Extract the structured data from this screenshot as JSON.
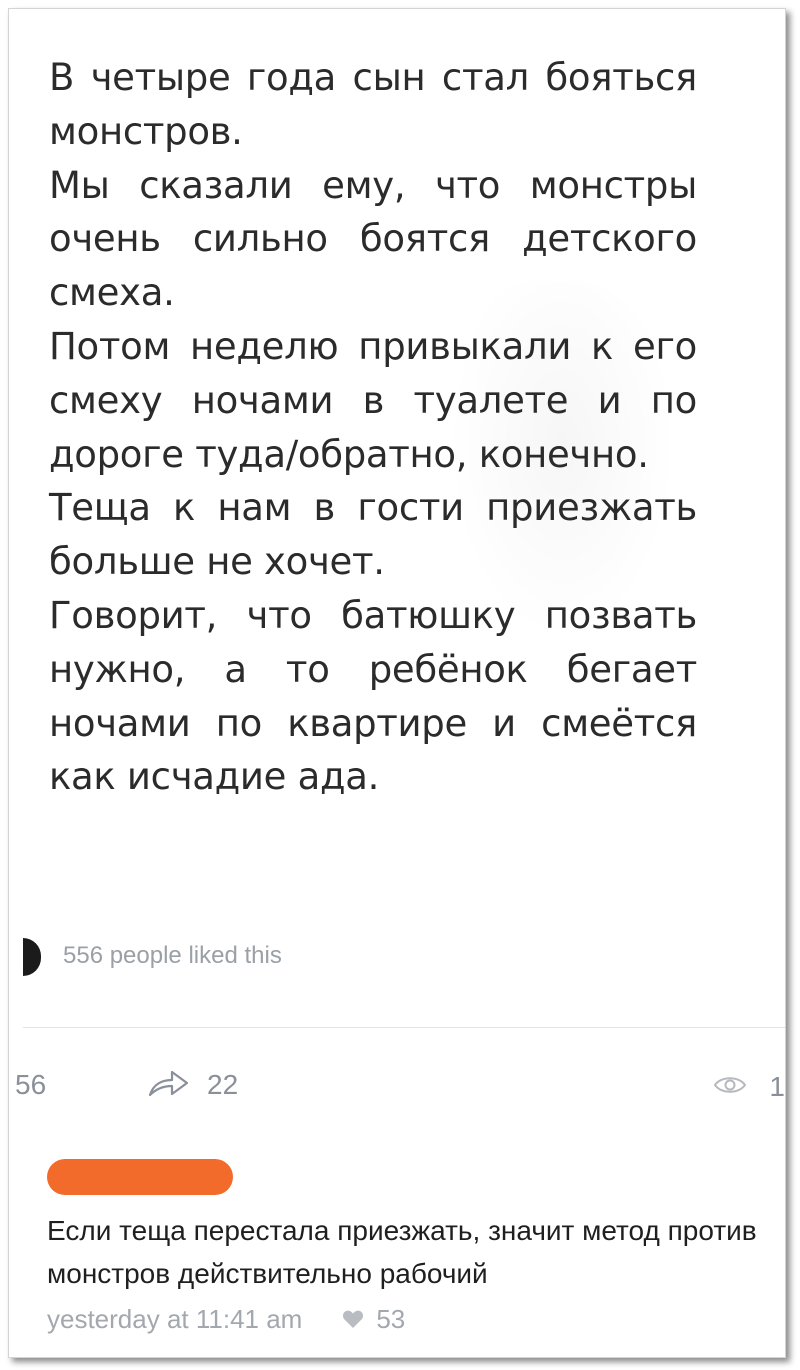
{
  "post": {
    "paragraphs": [
      "В четыре года сын стал бояться монстров.",
      "Мы сказали ему, что монстры очень сильно боятся детского смеха.",
      "Потом неделю привыкали к его смеху ночами в туалете и по дороге туда/обратно, конечно.",
      "Теща к нам в гости приезжать больше не хочет.",
      "Говорит, что батюшку позвать нужно, а то ребёнок бегает ночами по квартире и смеётся как исчадие ада."
    ]
  },
  "likes_summary": "556 people liked this",
  "actions": {
    "likes_count": "56",
    "share_count": "22",
    "views_count": "1"
  },
  "comment": {
    "text": "Если теща перестала приезжать, значит метод против монстров действительно рабочий",
    "timestamp": "yesterday at 11:41 am",
    "likes": "53"
  },
  "icons": {
    "share": "share-arrow-icon",
    "views": "eye-icon",
    "like": "heart-icon"
  },
  "colors": {
    "redaction": "#f26b2a",
    "muted_text": "#9aa0a6"
  }
}
